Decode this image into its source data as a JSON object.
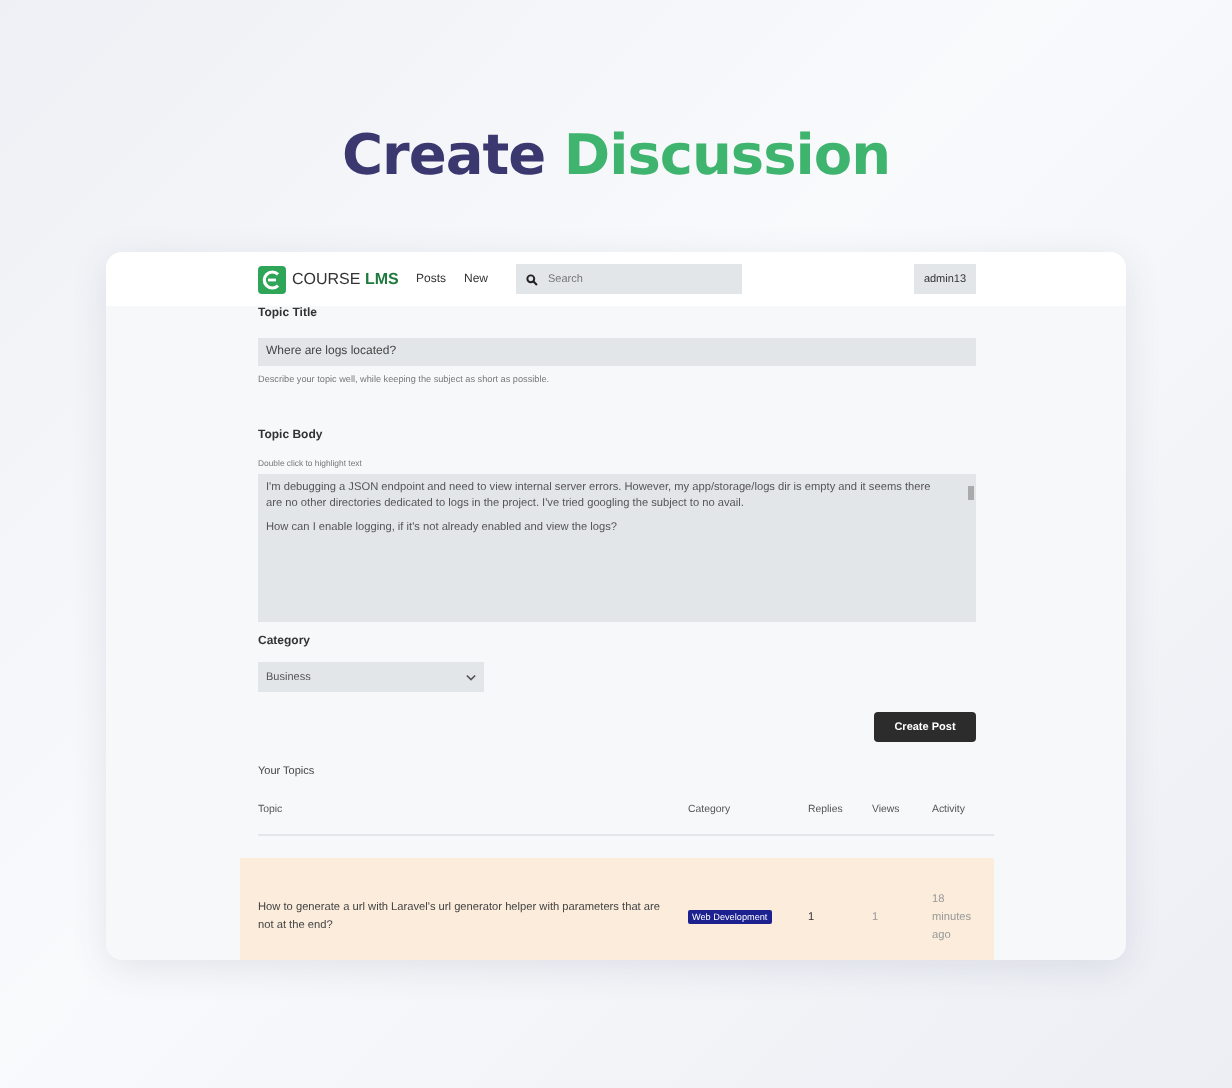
{
  "heading": {
    "lead": "Create",
    "accent": "Discussion"
  },
  "navbar": {
    "logo": {
      "brand": "COURSE",
      "accent": "LMS"
    },
    "links": [
      "Posts",
      "New"
    ],
    "search": {
      "placeholder": "Search"
    },
    "user": "admin13"
  },
  "form": {
    "title_field": {
      "label": "Topic Title",
      "value": "Where are logs located?",
      "hint": "Describe your topic well, while keeping the subject as short as possible."
    },
    "body_field": {
      "label": "Topic Body",
      "hint": "Double click to highlight text",
      "paragraphs": [
        "I'm debugging a JSON endpoint and need to view internal server errors. However, my app/storage/logs dir is empty and it seems there are no other directories dedicated to logs in the project. I've tried googling the subject to no avail.",
        "How can I enable logging, if it's not already enabled and view the logs?"
      ]
    },
    "category_field": {
      "label": "Category",
      "value": "Business"
    },
    "submit": "Create Post"
  },
  "topics": {
    "title": "Your Topics",
    "columns": [
      "Topic",
      "Category",
      "Replies",
      "Views",
      "Activity"
    ],
    "rows": [
      {
        "topic": "How to generate a url with Laravel's url generator helper with parameters that are not at the end?",
        "category": "Web Development",
        "replies": "1",
        "views": "1",
        "activity": "18 minutes ago",
        "highlighted": true
      }
    ]
  }
}
